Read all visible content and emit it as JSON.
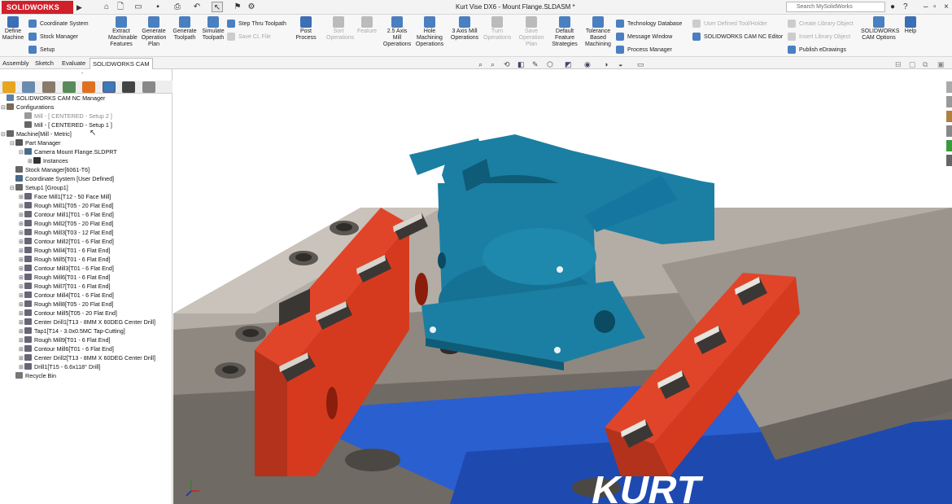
{
  "app": {
    "logo_text": "SOLIDWORKS",
    "window_title": "Kurt Vise DX6 - Mount Flange.SLDASM *"
  },
  "search": {
    "placeholder": "Search MySolidWorks"
  },
  "quick_access": [
    "home-icon",
    "new-doc-icon",
    "open-icon",
    "save-icon",
    "print-icon",
    "undo-icon",
    "select-icon",
    "rebuild-icon",
    "options-icon"
  ],
  "window_controls": [
    "user-icon",
    "help-icon",
    "minimize-icon",
    "restore-icon",
    "close-icon"
  ],
  "ribbon": {
    "large": [
      {
        "id": "define-machine",
        "label": "Define\nMachine",
        "color": "#3b6fb6",
        "disabled": false
      },
      {
        "id": "extract-machinable-features",
        "label": "Extract\nMachinable\nFeatures",
        "color": "#4a7fc0",
        "disabled": false
      },
      {
        "id": "generate-operation-plan",
        "label": "Generate\nOperation\nPlan",
        "color": "#4a7fc0",
        "disabled": false
      },
      {
        "id": "generate-toolpath",
        "label": "Generate\nToolpath",
        "color": "#4a7fc0",
        "disabled": false
      },
      {
        "id": "simulate-toolpath",
        "label": "Simulate\nToolpath",
        "color": "#4a7fc0",
        "disabled": false
      },
      {
        "id": "post-process",
        "label": "Post\nProcess",
        "color": "#3b6fb6",
        "disabled": false
      },
      {
        "id": "sort-operations",
        "label": "Sort\nOperations",
        "color": "#bbb",
        "disabled": true
      },
      {
        "id": "feature",
        "label": "Feature",
        "color": "#bbb",
        "disabled": true
      },
      {
        "id": "2-5-axis-mill",
        "label": "2.5 Axis\nMill\nOperations",
        "color": "#4a7fc0",
        "disabled": false
      },
      {
        "id": "hole-machining",
        "label": "Hole\nMachining\nOperations",
        "color": "#4a7fc0",
        "disabled": false
      },
      {
        "id": "3-axis-mill",
        "label": "3 Axis Mill\nOperations",
        "color": "#4a7fc0",
        "disabled": false
      },
      {
        "id": "turn-operations",
        "label": "Turn\nOperations",
        "color": "#bbb",
        "disabled": true
      },
      {
        "id": "save-operation-plan",
        "label": "Save\nOperation\nPlan",
        "color": "#bbb",
        "disabled": true
      },
      {
        "id": "default-feature-strategies",
        "label": "Default\nFeature\nStrategies",
        "color": "#4a7fc0",
        "disabled": false
      },
      {
        "id": "tolerance-based-machining",
        "label": "Tolerance\nBased\nMachining",
        "color": "#4a7fc0",
        "disabled": false
      },
      {
        "id": "solidworks-cam-options",
        "label": "SOLIDWORKS\nCAM Options",
        "color": "#4a7fc0",
        "disabled": false
      },
      {
        "id": "help",
        "label": "Help",
        "color": "#3b6fb6",
        "disabled": false
      }
    ],
    "small": [
      {
        "id": "coordinate-system",
        "label": "Coordinate System",
        "disabled": false
      },
      {
        "id": "stock-manager",
        "label": "Stock Manager",
        "disabled": false
      },
      {
        "id": "setup",
        "label": "Setup",
        "disabled": false
      },
      {
        "id": "step-thru-toolpath",
        "label": "Step Thru Toolpath",
        "disabled": false
      },
      {
        "id": "save-cl-file",
        "label": "Save CL File",
        "disabled": true
      },
      {
        "id": "technology-database",
        "label": "Technology Database",
        "disabled": false
      },
      {
        "id": "message-window",
        "label": "Message Window",
        "disabled": false
      },
      {
        "id": "process-manager",
        "label": "Process Manager",
        "disabled": false
      },
      {
        "id": "user-defined-tool",
        "label": "User Defined Tool/Holder",
        "disabled": true
      },
      {
        "id": "nc-editor",
        "label": "SOLIDWORKS CAM NC Editor",
        "disabled": false
      },
      {
        "id": "create-library-object",
        "label": "Create Library Object",
        "disabled": true
      },
      {
        "id": "insert-library-object",
        "label": "Insert Library Object",
        "disabled": true
      },
      {
        "id": "publish-edrawings",
        "label": "Publish eDrawings",
        "disabled": false
      }
    ]
  },
  "tabs": [
    "Assembly",
    "Sketch",
    "Evaluate",
    "SOLIDWORKS CAM"
  ],
  "active_tab": "SOLIDWORKS CAM",
  "tree": [
    {
      "label": "SOLIDWORKS CAM NC Manager",
      "level": 0,
      "toggle": "",
      "color": "#5a7fa8",
      "gray": false
    },
    {
      "label": "Configurations",
      "level": 0,
      "toggle": "−",
      "color": "#7a6a55",
      "gray": false
    },
    {
      "label": "Mill - [ CENTERED - Setup 2 ]",
      "level": 2,
      "toggle": "",
      "color": "#999",
      "gray": true
    },
    {
      "label": "Mill - [ CENTERED - Setup 1 ]",
      "level": 2,
      "toggle": "",
      "color": "#666",
      "gray": false
    },
    {
      "label": "Machine[Mill - Metric]",
      "level": 0,
      "toggle": "−",
      "color": "#666",
      "gray": false
    },
    {
      "label": "Part Manager",
      "level": 1,
      "toggle": "−",
      "color": "#555",
      "gray": false
    },
    {
      "label": "Camera Mount Flange.SLDPRT",
      "level": 2,
      "toggle": "−",
      "color": "#4a6a8a",
      "gray": false
    },
    {
      "label": "Instances",
      "level": 3,
      "toggle": "+",
      "color": "#333",
      "gray": false
    },
    {
      "label": "Stock Manager[6061-T6]",
      "level": 1,
      "toggle": "",
      "color": "#666",
      "gray": false
    },
    {
      "label": "Coordinate System [User Defined]",
      "level": 1,
      "toggle": "",
      "color": "#4a6a8a",
      "gray": false
    },
    {
      "label": "Setup1 [Group1]",
      "level": 1,
      "toggle": "−",
      "color": "#666",
      "gray": false
    },
    {
      "label": "Face Mill1[T12 - 50 Face Mill]",
      "level": 2,
      "toggle": "+",
      "color": "#667",
      "gray": false
    },
    {
      "label": "Rough Mill1[T05 - 20 Flat End]",
      "level": 2,
      "toggle": "+",
      "color": "#667",
      "gray": false
    },
    {
      "label": "Contour Mill1[T01 - 6 Flat End]",
      "level": 2,
      "toggle": "+",
      "color": "#667",
      "gray": false
    },
    {
      "label": "Rough Mill2[T05 - 20 Flat End]",
      "level": 2,
      "toggle": "+",
      "color": "#667",
      "gray": false
    },
    {
      "label": "Rough Mill3[T03 - 12 Flat End]",
      "level": 2,
      "toggle": "+",
      "color": "#667",
      "gray": false
    },
    {
      "label": "Contour Mill2[T01 - 6 Flat End]",
      "level": 2,
      "toggle": "+",
      "color": "#667",
      "gray": false
    },
    {
      "label": "Rough Mill4[T01 - 6 Flat End]",
      "level": 2,
      "toggle": "+",
      "color": "#667",
      "gray": false
    },
    {
      "label": "Rough Mill5[T01 - 6 Flat End]",
      "level": 2,
      "toggle": "+",
      "color": "#667",
      "gray": false
    },
    {
      "label": "Contour Mill3[T01 - 6 Flat End]",
      "level": 2,
      "toggle": "+",
      "color": "#667",
      "gray": false
    },
    {
      "label": "Rough Mill6[T01 - 6 Flat End]",
      "level": 2,
      "toggle": "+",
      "color": "#667",
      "gray": false
    },
    {
      "label": "Rough Mill7[T01 - 6 Flat End]",
      "level": 2,
      "toggle": "+",
      "color": "#667",
      "gray": false
    },
    {
      "label": "Contour Mill4[T01 - 6 Flat End]",
      "level": 2,
      "toggle": "+",
      "color": "#667",
      "gray": false
    },
    {
      "label": "Rough Mill8[T05 - 20 Flat End]",
      "level": 2,
      "toggle": "+",
      "color": "#667",
      "gray": false
    },
    {
      "label": "Contour Mill5[T05 - 20 Flat End]",
      "level": 2,
      "toggle": "+",
      "color": "#667",
      "gray": false
    },
    {
      "label": "Center Drill1[T13 - 8MM X 60DEG Center Drill]",
      "level": 2,
      "toggle": "+",
      "color": "#667",
      "gray": false
    },
    {
      "label": "Tap1[T14 - 3.0x0.5MC Tap-Cutting]",
      "level": 2,
      "toggle": "+",
      "color": "#667",
      "gray": false
    },
    {
      "label": "Rough Mill9[T01 - 6 Flat End]",
      "level": 2,
      "toggle": "+",
      "color": "#667",
      "gray": false
    },
    {
      "label": "Contour Mill6[T01 - 6 Flat End]",
      "level": 2,
      "toggle": "+",
      "color": "#667",
      "gray": false
    },
    {
      "label": "Center Drill2[T13 - 8MM X 60DEG Center Drill]",
      "level": 2,
      "toggle": "+",
      "color": "#667",
      "gray": false
    },
    {
      "label": "Drill1[T15 - 6.6x118° Drill]",
      "level": 2,
      "toggle": "+",
      "color": "#667",
      "gray": false
    },
    {
      "label": "Recycle Bin",
      "level": 1,
      "toggle": "",
      "color": "#777",
      "gray": false
    }
  ],
  "viewport": {
    "vise_logo_text": "KURT",
    "colors": {
      "part": "#1b7fa3",
      "part_dark": "#0f5c78",
      "jaw": "#d63a1e",
      "jaw_dark": "#9c2512",
      "body": "#b9b2a8",
      "body_dark": "#7a746c",
      "slot": "#2a5fd0"
    }
  }
}
